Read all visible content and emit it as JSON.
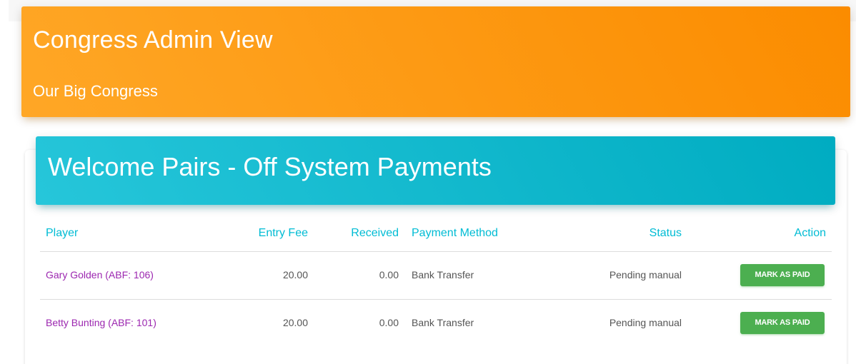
{
  "header": {
    "title": "Congress Admin View",
    "subtitle": "Our Big Congress"
  },
  "card": {
    "title": "Welcome Pairs - Off System Payments"
  },
  "table": {
    "columns": {
      "player": "Player",
      "entry_fee": "Entry Fee",
      "received": "Received",
      "payment_method": "Payment Method",
      "status": "Status",
      "action": "Action"
    },
    "rows": [
      {
        "player": "Gary Golden (ABF: 106)",
        "entry_fee": "20.00",
        "received": "0.00",
        "payment_method": "Bank Transfer",
        "status": "Pending manual",
        "action": "MARK AS PAID"
      },
      {
        "player": "Betty Bunting (ABF: 101)",
        "entry_fee": "20.00",
        "received": "0.00",
        "payment_method": "Bank Transfer",
        "status": "Pending manual",
        "action": "MARK AS PAID"
      }
    ]
  },
  "colors": {
    "header_orange": "#fb8c00",
    "card_cyan": "#00acc1",
    "column_header_text": "#00bcd4",
    "player_link": "#9c27b0",
    "action_button": "#4caf50"
  }
}
